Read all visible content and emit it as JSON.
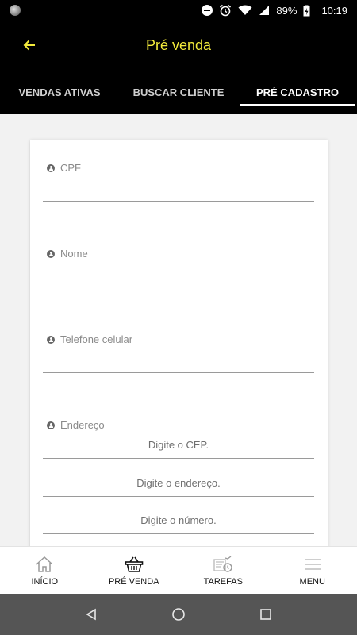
{
  "status_bar": {
    "battery_percent": "89%",
    "time": "10:19",
    "icons": [
      "notification-dot-icon",
      "do-not-disturb-icon",
      "alarm-icon",
      "wifi-icon",
      "signal-icon",
      "battery-charging-icon"
    ]
  },
  "header": {
    "title": "Pré venda",
    "back_icon": "arrow-left-icon",
    "title_color": "#f3ea3b",
    "background": "#000000"
  },
  "tabs": [
    {
      "label": "VENDAS ATIVAS",
      "active": false
    },
    {
      "label": "BUSCAR CLIENTE",
      "active": false
    },
    {
      "label": "PRÉ CADASTRO",
      "active": true
    }
  ],
  "form": {
    "cpf_label": "CPF",
    "cpf_value": "",
    "nome_label": "Nome",
    "nome_value": "",
    "telefone_label": "Telefone celular",
    "telefone_value": "",
    "endereco_label": "Endereço",
    "cep_placeholder": "Digite o CEP.",
    "endereco_placeholder": "Digite o endereço.",
    "numero_placeholder": "Digite o número."
  },
  "bottom_nav": [
    {
      "label": "INÍCIO",
      "icon": "home-icon"
    },
    {
      "label": "PRÉ VENDA",
      "icon": "basket-icon"
    },
    {
      "label": "TAREFAS",
      "icon": "tasks-icon"
    },
    {
      "label": "MENU",
      "icon": "menu-icon"
    }
  ],
  "system_nav": {
    "icons": [
      "back-triangle-icon",
      "home-circle-icon",
      "recents-square-icon"
    ]
  }
}
